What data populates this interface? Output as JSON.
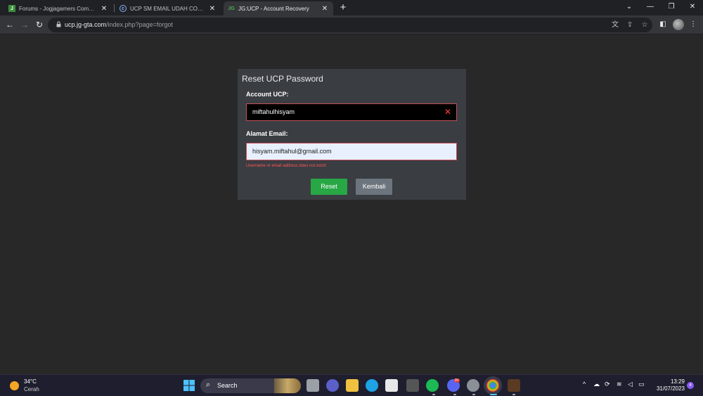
{
  "browser": {
    "tabs": [
      {
        "title": "Forums - Jogjagamers Community",
        "favicon": "jogjagamers-icon",
        "active": false
      },
      {
        "title": "UCP SM EMAIL UDAH COCOK TP",
        "favicon": "globe-icon",
        "active": false
      },
      {
        "title": "JG:UCP - Account Recovery",
        "favicon": "jgucp-icon",
        "active": true
      }
    ],
    "new_tab": "+",
    "url_host": "ucp.jg-gta.com",
    "url_path": "/index.php?page=forgot",
    "window_controls": [
      "⌄",
      "—",
      "❐",
      "✕"
    ]
  },
  "form": {
    "title": "Reset UCP Password",
    "account_label": "Account UCP:",
    "account_value": "miftahulhisyam",
    "email_label": "Alamat Email:",
    "email_value": "hisyam.miftahul@gmail.com",
    "error": "Username or email address does not exist!",
    "reset_label": "Reset",
    "back_label": "Kembali"
  },
  "taskbar": {
    "temperature": "34°C",
    "condition": "Cerah",
    "search_label": "Search",
    "time": "13:29",
    "date": "31/07/2023",
    "notification_count": "4",
    "discord_badge": "9+"
  }
}
